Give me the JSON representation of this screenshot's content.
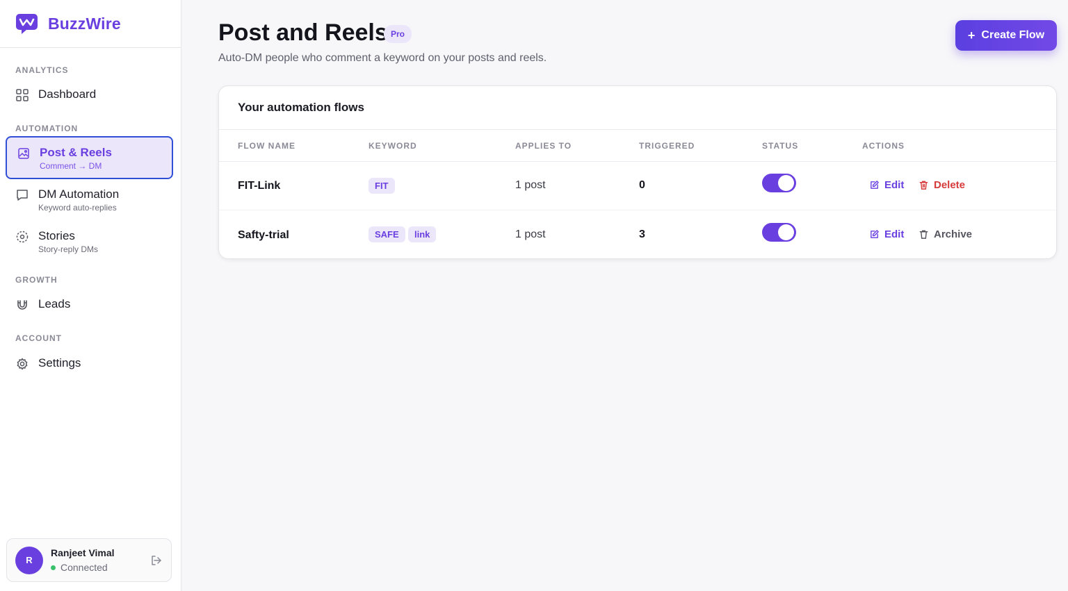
{
  "brand": {
    "name": "BuzzWire"
  },
  "sidebar": {
    "sections": [
      {
        "title": "ANALYTICS"
      },
      {
        "title": "AUTOMATION"
      },
      {
        "title": "GROWTH"
      },
      {
        "title": "ACCOUNT"
      }
    ],
    "items": [
      {
        "label": "Dashboard",
        "icon": "grid-icon"
      },
      {
        "label": "Post & Reels",
        "sub": "Comment → DM",
        "icon": "image-icon",
        "active": true
      },
      {
        "label": "DM Automation",
        "sub": "Keyword auto-replies",
        "icon": "message-icon"
      },
      {
        "label": "Stories",
        "sub": "Story-reply DMs",
        "icon": "story-icon"
      },
      {
        "label": "Leads",
        "icon": "magnet-icon"
      },
      {
        "label": "Settings",
        "icon": "gear-icon"
      }
    ]
  },
  "user": {
    "initial": "R",
    "name": "Ranjeet Vimal",
    "status": "Connected"
  },
  "header": {
    "title": "Post and Reels",
    "badge": "Pro",
    "subtitle": "Auto-DM people who comment a keyword on your posts and reels.",
    "create_button": "Create Flow"
  },
  "flows": {
    "title": "Your automation flows",
    "columns": [
      "FLOW NAME",
      "KEYWORD",
      "APPLIES TO",
      "TRIGGERED",
      "STATUS",
      "ACTIONS"
    ],
    "rows": [
      {
        "name": "FIT-Link",
        "keywords": [
          "FIT"
        ],
        "applies_to": "1 post",
        "triggered": "0",
        "status_on": true,
        "edit": "Edit",
        "secondary": "Delete"
      },
      {
        "name": "Safty-trial",
        "keywords": [
          "SAFE",
          "link"
        ],
        "applies_to": "1 post",
        "triggered": "3",
        "status_on": true,
        "edit": "Edit",
        "secondary": "Archive"
      }
    ]
  },
  "colors": {
    "accent": "#6a3fe0",
    "danger": "#d63a3a",
    "success": "#39c06b"
  }
}
